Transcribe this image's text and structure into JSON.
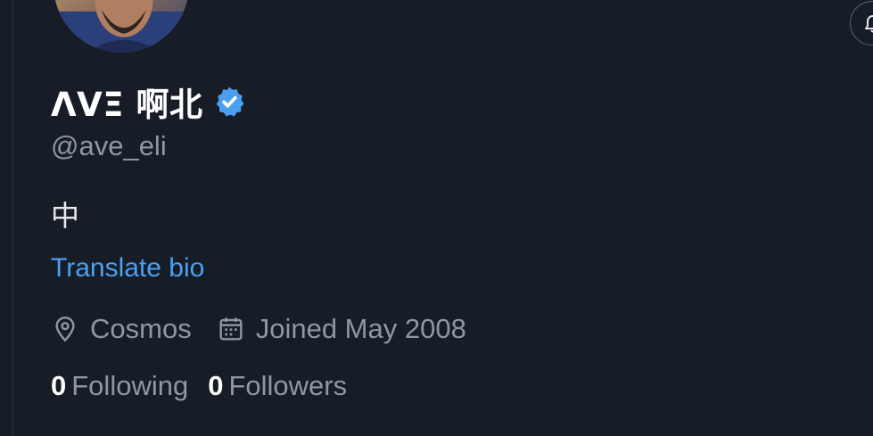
{
  "profile": {
    "display_name": "ΛVΞ 啊北",
    "handle": "@ave_eli",
    "bio": "中",
    "translate_label": "Translate bio",
    "verified": true,
    "verified_color": "#4a9ff0"
  },
  "meta": {
    "location": "Cosmos",
    "joined": "Joined May 2008"
  },
  "stats": {
    "following_count": "0",
    "following_label": "Following",
    "followers_count": "0",
    "followers_label": "Followers"
  },
  "icons": {
    "location": "map-pin-icon",
    "joined": "calendar-icon",
    "bell": "bell-icon",
    "verified": "verified-badge-icon"
  },
  "colors": {
    "background": "#171d26",
    "text_primary": "#e7e9ea",
    "text_secondary": "#8b98a5",
    "link": "#4a9ff0"
  }
}
